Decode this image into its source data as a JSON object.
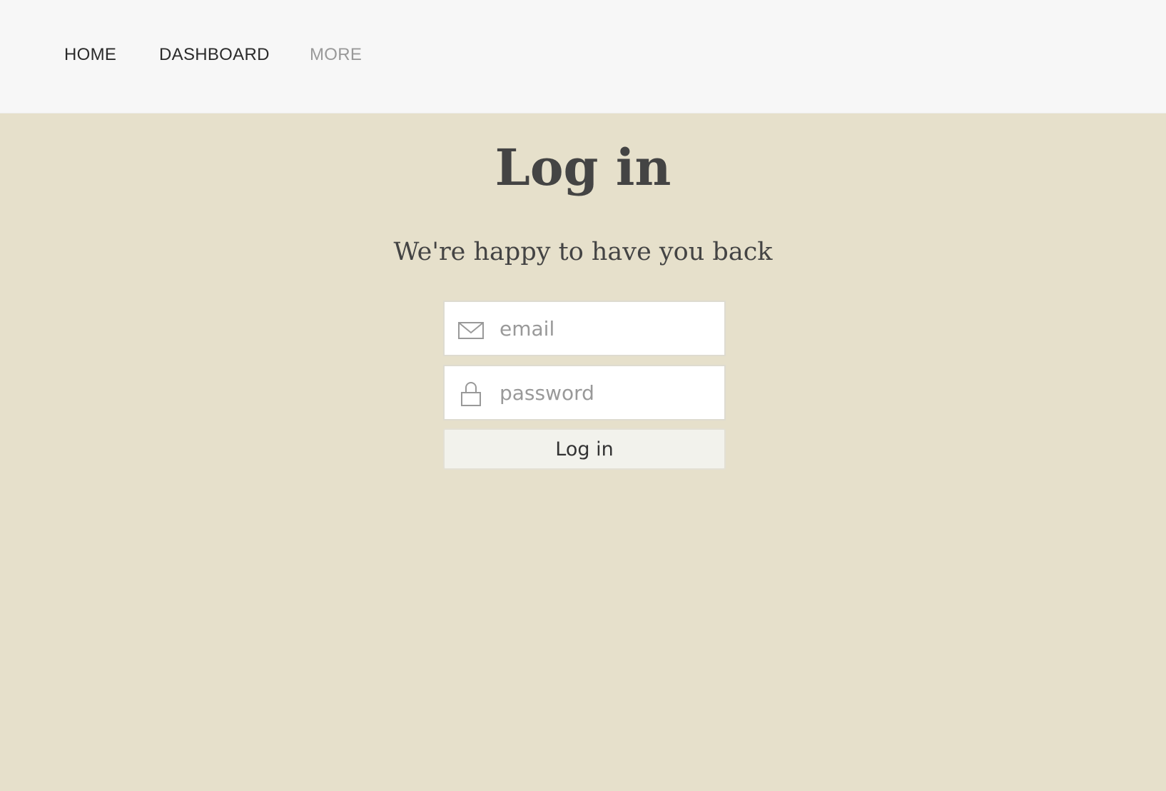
{
  "nav": {
    "items": [
      {
        "label": "HOME"
      },
      {
        "label": "DASHBOARD"
      },
      {
        "label": "MORE"
      }
    ]
  },
  "page": {
    "title": "Log in",
    "subtitle": "We're happy to have you back"
  },
  "form": {
    "email": {
      "placeholder": "email",
      "value": "",
      "icon": "envelope-icon"
    },
    "password": {
      "placeholder": "password",
      "value": "",
      "icon": "lock-icon"
    },
    "submit_label": "Log in"
  },
  "colors": {
    "background": "#e6e0cb",
    "topbar": "#f7f7f7",
    "text": "#444444",
    "muted": "#999999"
  }
}
